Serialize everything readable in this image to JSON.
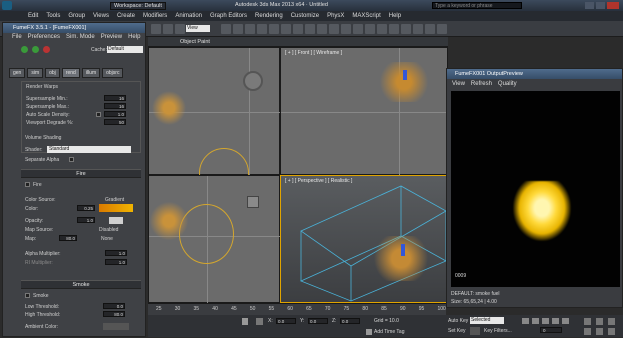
{
  "window": {
    "title": "Autodesk 3ds Max 2013 x64 · Untitled",
    "workspace": "Workspace: Default",
    "search_placeholder": "Type a keyword or phrase"
  },
  "menu": [
    "Edit",
    "Tools",
    "Group",
    "Views",
    "Create",
    "Modifiers",
    "Animation",
    "Graph Editors",
    "Rendering",
    "Customize",
    "PhysX",
    "MAXScript",
    "Help"
  ],
  "toolbar": {
    "selection_set": "View"
  },
  "viewports": {
    "top": "[ + ] [ Front ] [ Wireframe ]",
    "persp": "[ + ] [ Perspective ] [ Realistic ]",
    "object_paint": "Object Paint"
  },
  "fumefx_panel": {
    "title": "FumeFX 3.5.1 - [FumeFX001]",
    "menus": [
      "File",
      "Preferences",
      "Sim. Mode",
      "Preview",
      "Help"
    ],
    "cache_label": "Cache:",
    "cache_value": "Default",
    "tabs": [
      "gen",
      "sim",
      "obj",
      "rend",
      "illum",
      "objsrc"
    ],
    "render_warps": "Render Warps",
    "supersample_min_label": "Supersample Min.:",
    "supersample_min": "16",
    "supersample_max_label": "Supersample Max.:",
    "supersample_max": "16",
    "auto_scale_label": "Auto Scale Density:",
    "auto_scale_value": "1.0",
    "viewport_degrade_label": "Viewport Degrade %:",
    "viewport_degrade_value": "50",
    "volume_shading": "Volume Shading",
    "shader_label": "Shader:",
    "shader_value": "Standard",
    "separate_alpha": "Separate Alpha",
    "fire_section": "Fire",
    "fire_checkbox": "Fire",
    "color_source_label": "Color Source:",
    "color_source_value": "Gradient",
    "color_label": "Color:",
    "color_value": "0.25",
    "opacity_label": "Opacity:",
    "opacity_value": "1.0",
    "map_source_label": "Map Source:",
    "map_source_value": "Disabled",
    "map_label": "Map:",
    "map_value": "80.0",
    "map_none": "None",
    "alpha_mult_label": "Alpha Multiplier:",
    "alpha_mult_value": "1.0",
    "ri_mult_label": "RI Multiplier:",
    "ri_mult_value": "1.0",
    "smoke_section": "Smoke",
    "smoke_checkbox": "Smoke",
    "low_threshold_label": "Low Threshold:",
    "low_threshold_value": "0.0",
    "high_threshold_label": "High Threshold:",
    "high_threshold_value": "80.0",
    "ambient_label": "Ambient Color:"
  },
  "preview": {
    "title": "FumeFX001 OutputPreview",
    "menus": [
      "View",
      "Refresh",
      "Quality"
    ],
    "frame": "0009",
    "status1": "DEFAULT: smoke fuel",
    "status2": "Size: 65,65,24 | 4.00"
  },
  "timeline": {
    "ticks": [
      "25",
      "30",
      "35",
      "40",
      "45",
      "50",
      "55",
      "60",
      "65",
      "70",
      "75",
      "80",
      "85",
      "90",
      "95",
      "100"
    ],
    "x_value": "0.0",
    "y_value": "0.0",
    "z_value": "0.0",
    "grid_label": "Grid = 10.0",
    "add_time_tag": "Add Time Tag",
    "auto_key": "Auto Key",
    "selected": "Selected",
    "set_key": "Set Key",
    "key_filters": "Key Filters...",
    "frame_field": "0"
  },
  "colors": {
    "accent": "#f0b400",
    "viewport_bg": "#6b6b6b",
    "fire_gradient": "#f0a000"
  }
}
